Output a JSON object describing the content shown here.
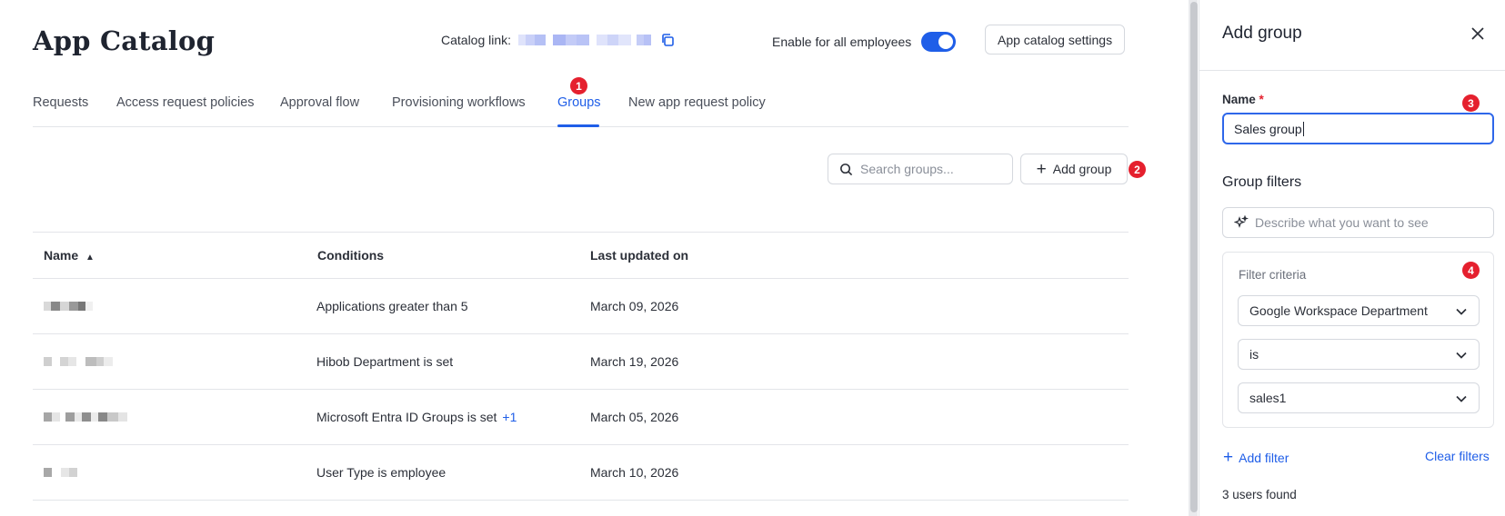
{
  "header": {
    "title": "App Catalog",
    "catalog_link_label": "Catalog link:",
    "enable_label": "Enable for all employees",
    "enable_on": true,
    "settings_button": "App catalog settings"
  },
  "tabs": [
    {
      "label": "Requests",
      "active": false
    },
    {
      "label": "Access request policies",
      "active": false
    },
    {
      "label": "Approval flow",
      "active": false
    },
    {
      "label": "Provisioning workflows",
      "active": false
    },
    {
      "label": "Groups",
      "active": true
    },
    {
      "label": "New app request policy",
      "active": false
    }
  ],
  "toolbar": {
    "search_placeholder": "Search groups...",
    "add_group_label": "Add group"
  },
  "table": {
    "columns": [
      "Name",
      "Conditions",
      "Last updated on"
    ],
    "sort_indicator": "▲",
    "rows": [
      {
        "condition": "Applications greater than 5",
        "more": "",
        "updated": "March 09, 2026"
      },
      {
        "condition": "Hibob Department is set",
        "more": "",
        "updated": "March 19, 2026"
      },
      {
        "condition": "Microsoft Entra ID Groups is set",
        "more": "+1",
        "updated": "March 05, 2026"
      },
      {
        "condition": "User Type is employee",
        "more": "",
        "updated": "March 10, 2026"
      }
    ]
  },
  "annotations": [
    "1",
    "2",
    "3",
    "4"
  ],
  "panel": {
    "title": "Add group",
    "name_label": "Name",
    "required_mark": "*",
    "name_value": "Sales group",
    "filters_title": "Group filters",
    "ai_placeholder": "Describe what you want to see",
    "criteria_label": "Filter criteria",
    "criteria": [
      "Google Workspace Department",
      "is",
      "sales1"
    ],
    "add_filter": "Add filter",
    "clear_filters": "Clear filters",
    "users_found": "3 users found"
  },
  "colors": {
    "accent": "#1f5ee8",
    "badge": "#e5202e"
  }
}
